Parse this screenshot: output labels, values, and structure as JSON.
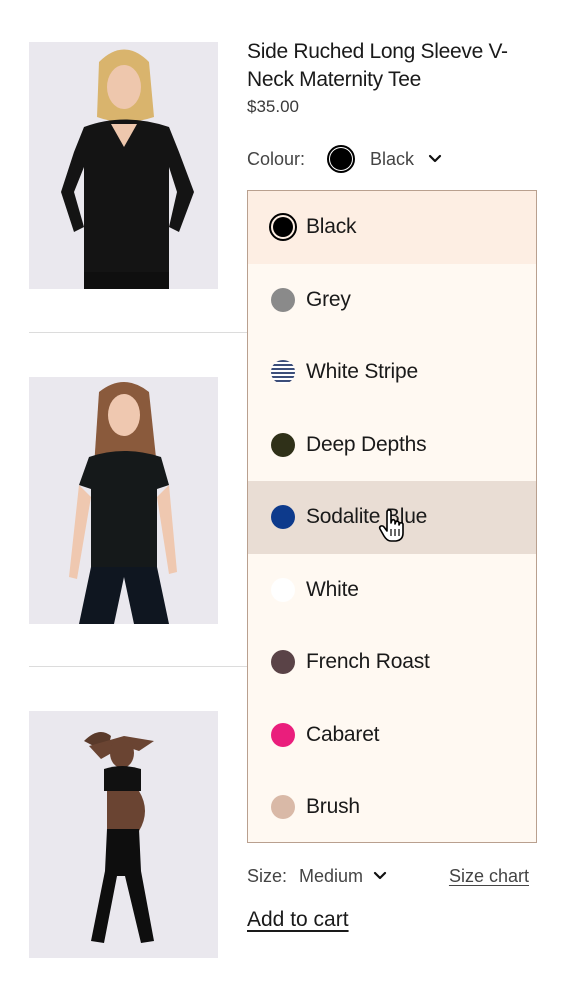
{
  "product": {
    "title": "Side Ruched Long Sleeve V-Neck Maternity Tee",
    "price": "$35.00"
  },
  "colour": {
    "label": "Colour:",
    "selected": "Black",
    "options": [
      {
        "label": "Black",
        "color": "#000000"
      },
      {
        "label": "Grey",
        "color": "#8a8a8a"
      },
      {
        "label": "White Stripe",
        "color": "#3c4e7a"
      },
      {
        "label": "Deep Depths",
        "color": "#2f3018"
      },
      {
        "label": "Sodalite Blue",
        "color": "#0d3a8c"
      },
      {
        "label": "White",
        "color": "#ffffff"
      },
      {
        "label": "French Roast",
        "color": "#5a4347"
      },
      {
        "label": "Cabaret",
        "color": "#ea1e7c"
      },
      {
        "label": "Brush",
        "color": "#d9b9a7"
      }
    ]
  },
  "size": {
    "label": "Size:",
    "value": "Medium",
    "chart_link": "Size chart"
  },
  "actions": {
    "add_to_cart": "Add to cart"
  },
  "icons": {
    "dropdown": "chevron-down-icon",
    "cursor": "hand-pointer-icon"
  }
}
